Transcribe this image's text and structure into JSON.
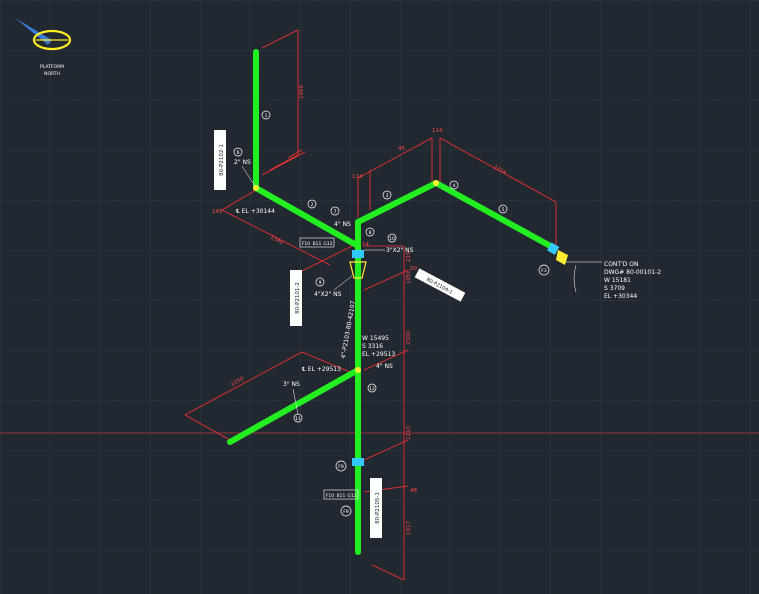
{
  "viewport": {
    "background": "#212830",
    "crosshair_color": "#c04040"
  },
  "north_arrow": {
    "line1": "PLATFORM",
    "line2": "NORTH"
  },
  "colors": {
    "pipe": "#22ee22",
    "dimension": "#ff3030",
    "text": "#ffffff",
    "fitting": "#33c8ff",
    "support": "#ffee33"
  },
  "labels": {
    "el_left": "℄ EL +30144",
    "ns2": "2\" NS",
    "ns4_top": "4\" NS",
    "ns_3x2": "3\"X2\" NS",
    "ns_4x2": "4\"X2\" NS",
    "w_val": "W 15495",
    "s_val": "S 3316",
    "el_val": "EL +29513",
    "el_mid": "℄ EL +29513",
    "ns4_mid": "4\" NS",
    "ns3": "3\" NS",
    "conto_1": "CONT'D ON",
    "conto_2": "DWG# 80-00101-2",
    "conto_3": "W 15181",
    "conto_4": "S 3709",
    "conto_5": "EL +30344"
  },
  "line_numbers": {
    "vertical_main": "4\"-P2103-80-42107",
    "left_tag": "80-P2102-1",
    "right_tag": "80-P2104-1",
    "left_low_tag": "80-P2101-2",
    "bottom_tag": "80-P2105-1"
  },
  "dimensions": {
    "top_vertical": "1400",
    "top_left_small": "145",
    "top_small": "114",
    "top_a": "45",
    "top_b": "114",
    "top_long": "2214",
    "left_diag": "1340",
    "left_small": "14",
    "v1": "219",
    "v2": "1050",
    "v3": "2300",
    "v4": "1210",
    "v5": "1017",
    "lower_diag": "2250",
    "small_a": "48",
    "small_b": "50"
  },
  "bubbles": [
    "1",
    "2",
    "3",
    "4",
    "5",
    "6",
    "7",
    "8",
    "9",
    "10",
    "11",
    "12"
  ],
  "fitting_tags": {
    "f_upper": [
      "F10",
      "B11",
      "G12"
    ],
    "f_lower": [
      "F10",
      "B11",
      "G12"
    ],
    "f_right": "F3",
    "f_mid": "F9",
    "f_low": "F9",
    "f_bottom": "F9"
  }
}
